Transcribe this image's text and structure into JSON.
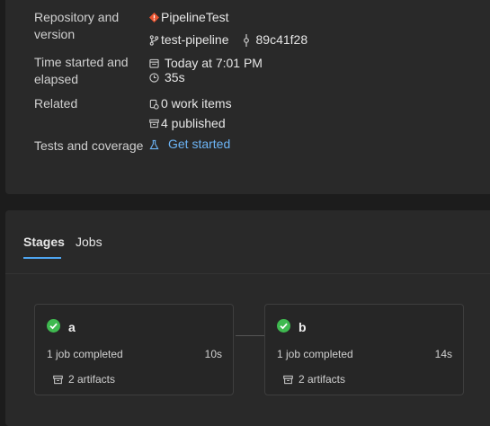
{
  "summary": {
    "repo_label": "Repository and version",
    "repo_name": "PipelineTest",
    "branch": "test-pipeline",
    "commit": "89c41f28",
    "time_label": "Time started and elapsed",
    "started": "Today at 7:01 PM",
    "elapsed": "35s",
    "related_label": "Related",
    "work_items": "0 work items",
    "published": "4 published",
    "tests_label": "Tests and coverage",
    "tests_link": "Get started"
  },
  "tabs": [
    {
      "label": "Stages",
      "active": true
    },
    {
      "label": "Jobs",
      "active": false
    }
  ],
  "stages": [
    {
      "name": "a",
      "jobs": "1 job completed",
      "duration": "10s",
      "artifacts": "2 artifacts"
    },
    {
      "name": "b",
      "jobs": "1 job completed",
      "duration": "14s",
      "artifacts": "2 artifacts"
    }
  ],
  "colors": {
    "success": "#3fb950",
    "accent": "#4ea5f0",
    "repo_icon": "#e8532f",
    "link": "#6cb4f5"
  }
}
